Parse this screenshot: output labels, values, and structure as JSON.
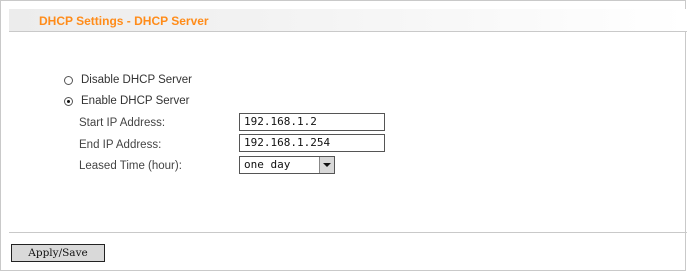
{
  "header": {
    "title": "DHCP Settings - DHCP Server"
  },
  "dhcp_mode": {
    "selected": "enable",
    "options": [
      {
        "label": "Disable DHCP Server"
      },
      {
        "label": "Enable DHCP Server"
      }
    ]
  },
  "fields": {
    "start_ip": {
      "label": "Start IP Address:",
      "value": "192.168.1.2"
    },
    "end_ip": {
      "label": "End IP Address:",
      "value": "192.168.1.254"
    },
    "lease_time": {
      "label": "Leased Time (hour):",
      "value": "one day"
    }
  },
  "actions": {
    "apply_label": "Apply/Save"
  }
}
